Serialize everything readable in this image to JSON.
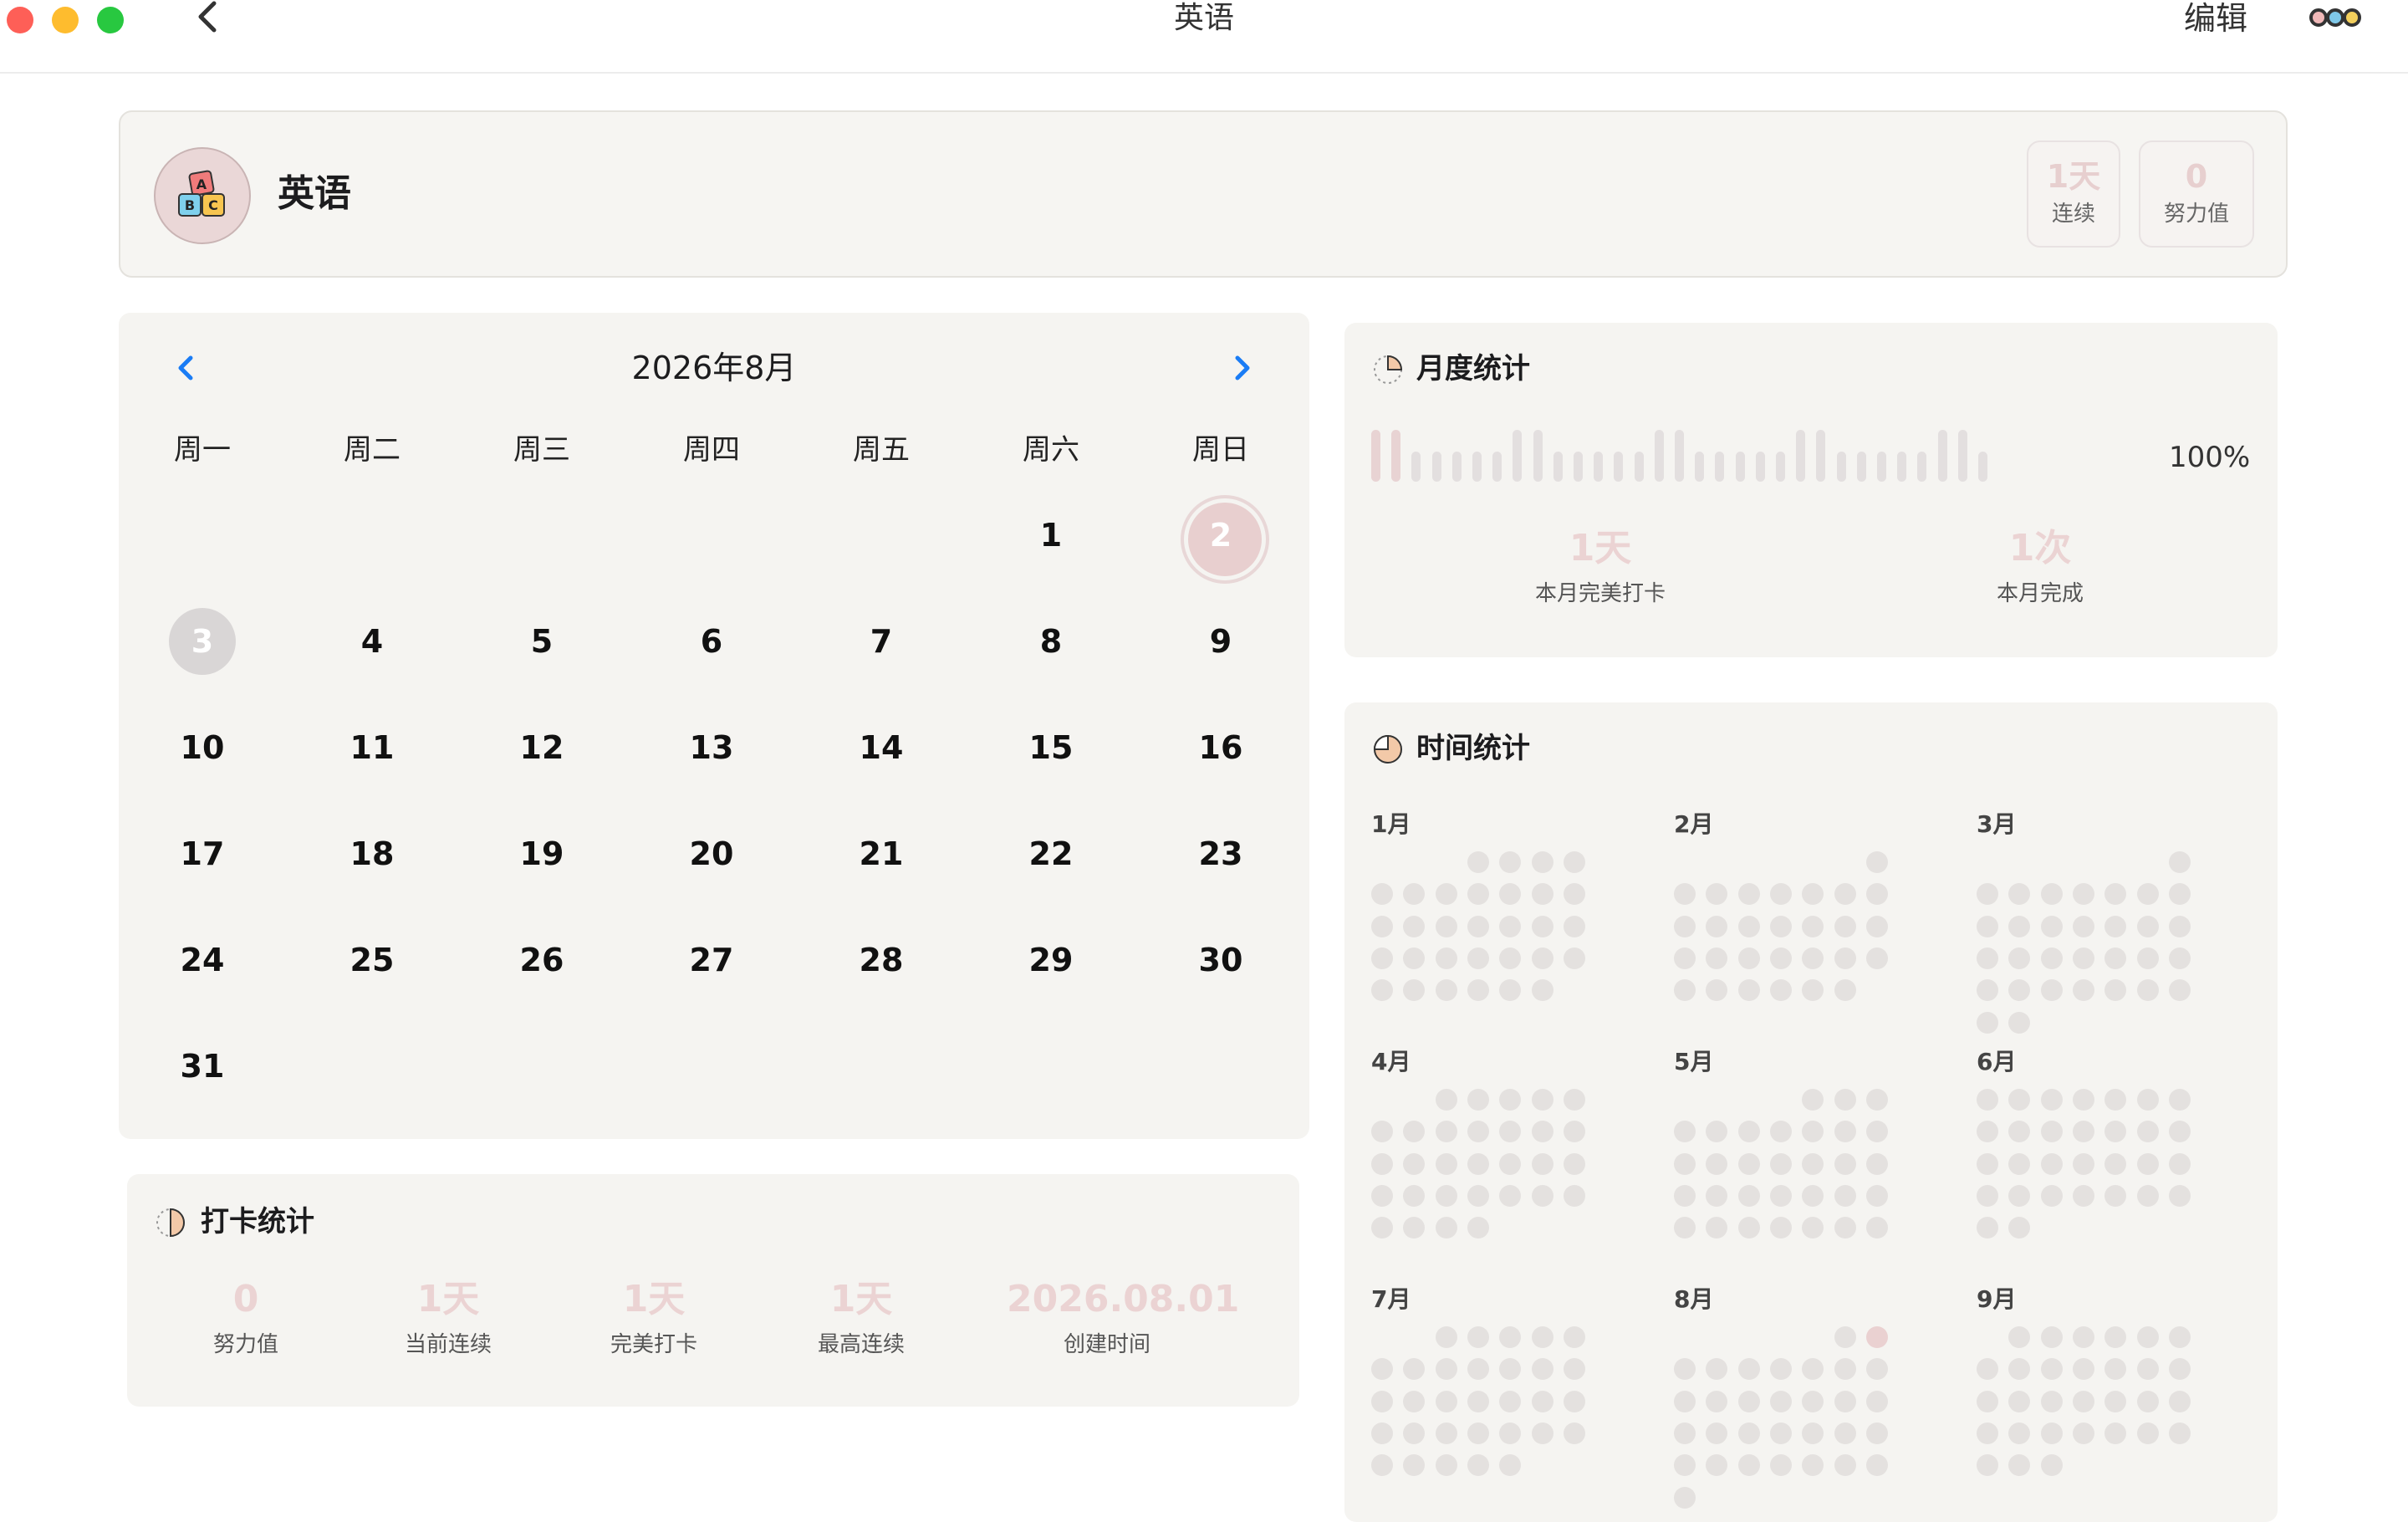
{
  "window": {
    "title": "英语",
    "edit_label": "编辑"
  },
  "habit": {
    "name": "英语",
    "streak_value": "1天",
    "streak_label": "连续",
    "effort_value": "0",
    "effort_label": "努力值"
  },
  "calendar": {
    "title": "2026年8月",
    "weekdays": [
      "周一",
      "周二",
      "周三",
      "周四",
      "周五",
      "周六",
      "周日"
    ],
    "first_weekday_index": 5,
    "days_in_month": 31,
    "today": 2,
    "marked": [
      3
    ]
  },
  "checkin_stats": {
    "title": "打卡统计",
    "items": [
      {
        "value": "0",
        "label": "努力值"
      },
      {
        "value": "1天",
        "label": "当前连续"
      },
      {
        "value": "1天",
        "label": "完美打卡"
      },
      {
        "value": "1天",
        "label": "最高连续"
      },
      {
        "value": "2026.08.01",
        "label": "创建时间"
      }
    ]
  },
  "monthly_stats": {
    "title": "月度统计",
    "percent": "100%",
    "bars_count": 31,
    "highlighted_days": [
      1,
      2
    ],
    "items": [
      {
        "value": "1天",
        "label": "本月完美打卡"
      },
      {
        "value": "1次",
        "label": "本月完成"
      }
    ]
  },
  "time_stats": {
    "title": "时间统计",
    "year": 2026,
    "months": [
      "1月",
      "2月",
      "3月",
      "4月",
      "5月",
      "6月",
      "7月",
      "8月",
      "9月"
    ],
    "highlighted": [
      {
        "month": 8,
        "day": 2
      }
    ]
  },
  "colors": {
    "accent": "#1a7cf5",
    "highlight": "#e8cfcf",
    "panel": "#f5f4f1"
  }
}
